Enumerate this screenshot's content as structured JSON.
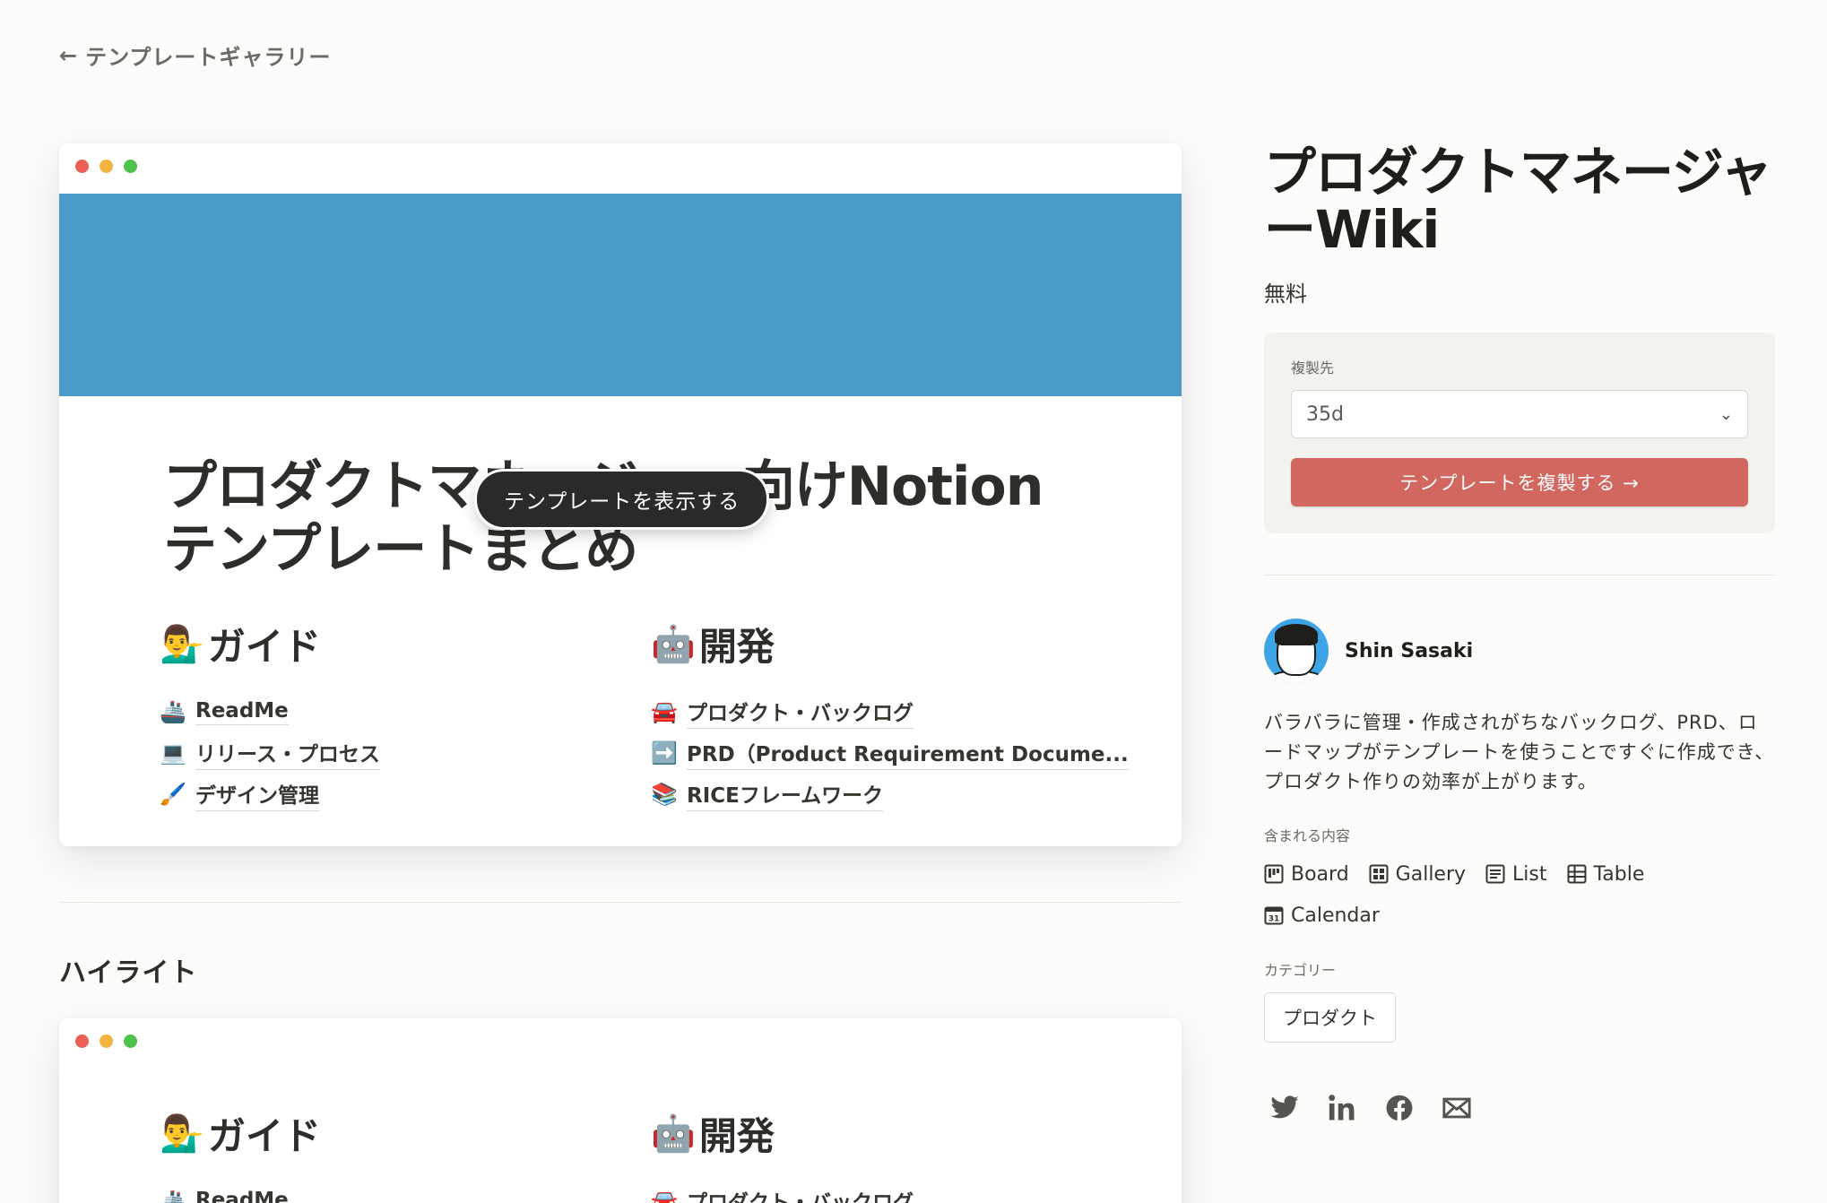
{
  "nav": {
    "back_label": "テンプレートギャラリー"
  },
  "preview": {
    "doc_title": "プロダクトマネージャー向けNotionテンプレートまとめ",
    "tooltip": "テンプレートを表示する",
    "columns": [
      {
        "heading_emoji": "💁‍♂️",
        "heading": "ガイド",
        "items": [
          {
            "emoji": "🚢",
            "label": "ReadMe"
          },
          {
            "emoji": "💻",
            "label": "リリース・プロセス"
          },
          {
            "emoji": "🖌️",
            "label": "デザイン管理"
          }
        ]
      },
      {
        "heading_emoji": "🤖",
        "heading": "開発",
        "items": [
          {
            "emoji": "🚘",
            "label": "プロダクト・バックログ"
          },
          {
            "emoji": "➡️",
            "label": "PRD（Product Requirement Docume..."
          },
          {
            "emoji": "📚",
            "label": "RICEフレームワーク"
          }
        ]
      }
    ]
  },
  "highlight": {
    "title": "ハイライト",
    "columns": [
      {
        "heading_emoji": "💁‍♂️",
        "heading": "ガイド",
        "first_item_emoji": "🚢",
        "first_item": "ReadMe"
      },
      {
        "heading_emoji": "🤖",
        "heading": "開発",
        "first_item_emoji": "🚘",
        "first_item": "プロダクト・バックログ"
      }
    ]
  },
  "sidebar": {
    "title": "プロダクトマネージャーWiki",
    "price": "無料",
    "duplicate": {
      "label": "複製先",
      "workspace": "35d",
      "button": "テンプレートを複製する →"
    },
    "author": {
      "name": "Shin Sasaki"
    },
    "description": "バラバラに管理・作成されがちなバックログ、PRD、ロードマップがテンプレートを使うことですぐに作成でき、プロダクト作りの効率が上がります。",
    "includes_label": "含まれる内容",
    "includes": [
      "Board",
      "Gallery",
      "List",
      "Table",
      "Calendar"
    ],
    "category_label": "カテゴリー",
    "category": "プロダクト",
    "share_icons": [
      "twitter-icon",
      "linkedin-icon",
      "facebook-icon",
      "mail-icon"
    ]
  },
  "colors": {
    "cover": "#4b9bc7",
    "accent_button": "#d1675e",
    "background": "#fdfcfb"
  }
}
